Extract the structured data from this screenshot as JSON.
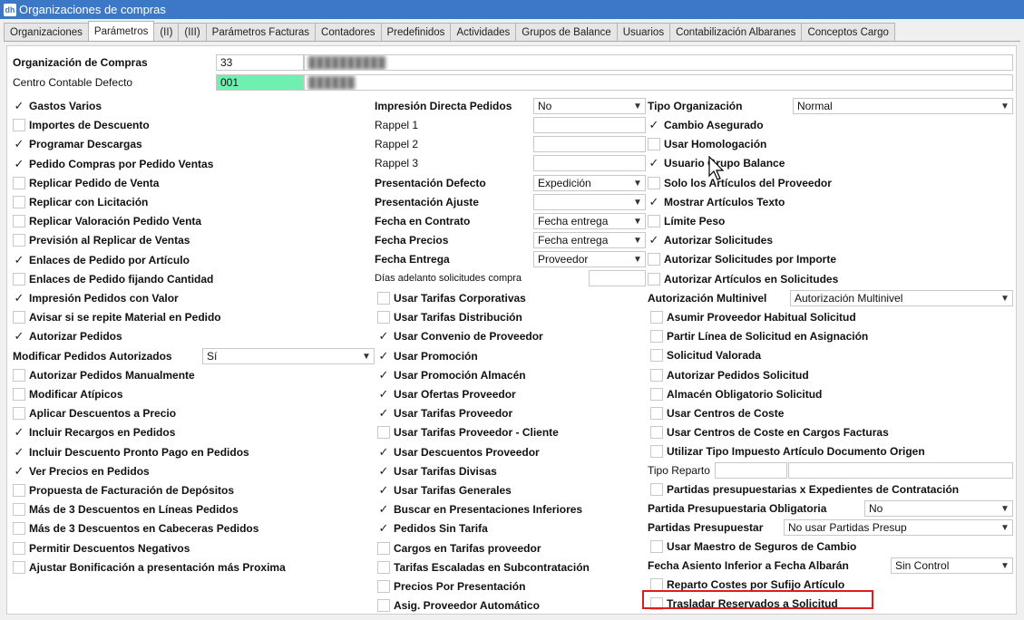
{
  "window": {
    "title": "Organizaciones de compras",
    "icon": "app-logo-icon"
  },
  "tabs": [
    "Organizaciones",
    "Parámetros",
    "(II)",
    "(III)",
    "Parámetros Facturas",
    "Contadores",
    "Predefinidos",
    "Actividades",
    "Grupos de Balance",
    "Usuarios",
    "Contabilización Albaranes",
    "Conceptos Cargo"
  ],
  "active_tab": "Parámetros",
  "header": {
    "org_label": "Organización de Compras",
    "org_code": "33",
    "org_name": "",
    "centro_label": "Centro Contable Defecto",
    "centro_code": "001",
    "centro_name": ""
  },
  "col1": [
    {
      "label": "Gastos Varios",
      "checked": true
    },
    {
      "label": "Importes de Descuento",
      "checked": false
    },
    {
      "label": "Programar Descargas",
      "checked": true
    },
    {
      "label": "Pedido Compras por Pedido Ventas",
      "checked": true
    },
    {
      "label": "Replicar Pedido de Venta",
      "checked": false
    },
    {
      "label": "Replicar con Licitación",
      "checked": false
    },
    {
      "label": "Replicar Valoración Pedido Venta",
      "checked": false
    },
    {
      "label": "Previsión al Replicar de Ventas",
      "checked": false
    },
    {
      "label": "Enlaces de Pedido por Artículo",
      "checked": true
    },
    {
      "label": "Enlaces de Pedido fijando Cantidad",
      "checked": false
    },
    {
      "label": "Impresión Pedidos con Valor",
      "checked": true
    },
    {
      "label": "Avisar si se repite Material en Pedido",
      "checked": false
    },
    {
      "label": "Autorizar Pedidos",
      "checked": true
    },
    {
      "label": "__select__"
    },
    {
      "label": "Autorizar Pedidos Manualmente",
      "checked": false
    },
    {
      "label": "Modificar Atípicos",
      "checked": false
    },
    {
      "label": "Aplicar Descuentos a Precio",
      "checked": false
    },
    {
      "label": "Incluir Recargos en Pedidos",
      "checked": true
    },
    {
      "label": "Incluir Descuento Pronto Pago en Pedidos",
      "checked": true
    },
    {
      "label": "Ver Precios en Pedidos",
      "checked": true
    },
    {
      "label": "Propuesta de Facturación de Depósitos",
      "checked": false
    },
    {
      "label": "Más de 3 Descuentos en Líneas Pedidos",
      "checked": false
    },
    {
      "label": "Más de 3 Descuentos en Cabeceras Pedidos",
      "checked": false
    },
    {
      "label": "Permitir Descuentos Negativos",
      "checked": false
    },
    {
      "label": "Ajustar Bonificación a presentación más Proxima",
      "checked": false
    }
  ],
  "modificar_pedidos": {
    "label": "Modificar Pedidos Autorizados",
    "value": "Sí"
  },
  "col2_top": {
    "impresion_label": "Impresión Directa Pedidos",
    "impresion_value": "No",
    "rappel1": "Rappel 1",
    "rappel2": "Rappel 2",
    "rappel3": "Rappel 3",
    "pres_defecto_label": "Presentación Defecto",
    "pres_defecto_value": "Expedición",
    "pres_ajuste_label": "Presentación Ajuste",
    "pres_ajuste_value": "",
    "fecha_contrato_label": "Fecha en Contrato",
    "fecha_contrato_value": "Fecha entrega",
    "fecha_precios_label": "Fecha Precios",
    "fecha_precios_value": "Fecha entrega",
    "fecha_entrega_label": "Fecha Entrega",
    "fecha_entrega_value": "Proveedor",
    "dias_label": "Días adelanto solicitudes compra"
  },
  "col2": [
    {
      "label": "Usar Tarifas Corporativas",
      "checked": false
    },
    {
      "label": "Usar Tarifas Distribución",
      "checked": false
    },
    {
      "label": "Usar Convenio de Proveedor",
      "checked": true
    },
    {
      "label": "Usar Promoción",
      "checked": true
    },
    {
      "label": "Usar Promoción Almacén",
      "checked": true
    },
    {
      "label": "Usar Ofertas Proveedor",
      "checked": true
    },
    {
      "label": "Usar Tarifas Proveedor",
      "checked": true
    },
    {
      "label": "Usar Tarifas Proveedor - Cliente",
      "checked": false
    },
    {
      "label": "Usar Descuentos Proveedor",
      "checked": true
    },
    {
      "label": "Usar Tarifas Divisas",
      "checked": true
    },
    {
      "label": "Usar Tarifas Generales",
      "checked": true
    },
    {
      "label": "Buscar en Presentaciones Inferiores",
      "checked": true
    },
    {
      "label": "Pedidos Sin Tarifa",
      "checked": true
    },
    {
      "label": "Cargos en Tarifas proveedor",
      "checked": false
    },
    {
      "label": "Tarifas Escaladas en Subcontratación",
      "checked": false
    },
    {
      "label": "Precios Por Presentación",
      "checked": false
    },
    {
      "label": "Asig. Proveedor Automático",
      "checked": false
    }
  ],
  "col3_top": {
    "tipo_org_label": "Tipo Organización",
    "tipo_org_value": "Normal"
  },
  "col3a": [
    {
      "label": "Cambio Asegurado",
      "checked": true
    },
    {
      "label": "Usar Homologación",
      "checked": false
    },
    {
      "label": "Usuario Grupo Balance",
      "checked": true
    },
    {
      "label": "Solo los Artículos del Proveedor",
      "checked": false
    },
    {
      "label": "Mostrar Artículos Texto",
      "checked": true
    },
    {
      "label": "Límite Peso",
      "checked": false
    },
    {
      "label": "Autorizar Solicitudes",
      "checked": true
    },
    {
      "label": "Autorizar Solicitudes por Importe",
      "checked": false
    },
    {
      "label": "Autorizar Artículos en Solicitudes",
      "checked": false
    }
  ],
  "autorizacion_multinivel": {
    "label": "Autorización Multinivel",
    "value": "Autorización Multinivel"
  },
  "col3b": [
    {
      "label": "Asumir Proveedor Habitual Solicitud",
      "checked": false
    },
    {
      "label": "Partir Línea de Solicitud en Asignación",
      "checked": false
    },
    {
      "label": "Solicitud Valorada",
      "checked": false
    },
    {
      "label": "Autorizar Pedidos Solicitud",
      "checked": false
    },
    {
      "label": "Almacén Obligatorio Solicitud",
      "checked": false
    },
    {
      "label": "Usar Centros de Coste",
      "checked": false
    },
    {
      "label": "Usar Centros de Coste en Cargos Facturas",
      "checked": false
    },
    {
      "label": "Utilizar Tipo Impuesto Artículo Documento Origen",
      "checked": false
    }
  ],
  "tipo_reparto_label": "Tipo Reparto",
  "partidas_exp": {
    "label": "Partidas presupuestarias x Expedientes de Contratación",
    "checked": false
  },
  "partida_oblig": {
    "label": "Partida Presupuestaria Obligatoria",
    "value": "No"
  },
  "partidas_presup": {
    "label": "Partidas Presupuestar",
    "value": "No usar Partidas Presup"
  },
  "maestro_seguros": {
    "label": "Usar Maestro de Seguros de Cambio",
    "checked": false
  },
  "fecha_asiento": {
    "label": "Fecha Asiento Inferior a Fecha Albarán",
    "value": "Sin Control"
  },
  "col3c": [
    {
      "label": "Reparto Costes por Sufijo Artículo",
      "checked": false
    },
    {
      "label": "Trasladar Reservados a Solicitud",
      "checked": false
    }
  ],
  "glyphs": {
    "check": "✓",
    "arrow": "▼"
  },
  "colors": {
    "titlebar": "#3c78c6",
    "code_highlight": "#6ff0b0",
    "annotation": "#e01b1b"
  }
}
